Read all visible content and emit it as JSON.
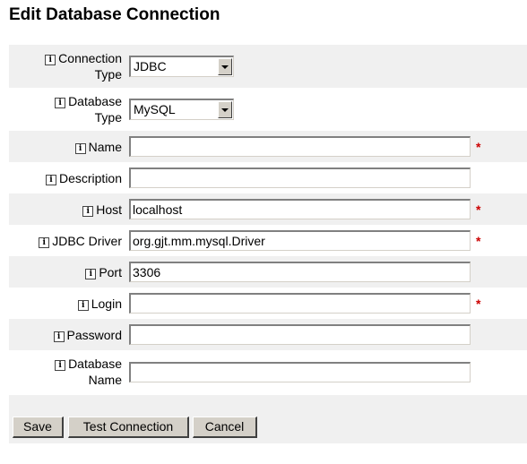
{
  "page": {
    "title": "Edit Database Connection"
  },
  "form": {
    "info_icon_glyph": "i",
    "required_mark": "*",
    "connection_type": {
      "label_line1": "Connection",
      "label_line2": "Type",
      "value": "JDBC"
    },
    "database_type": {
      "label_line1": "Database",
      "label_line2": "Type",
      "value": "MySQL"
    },
    "name": {
      "label": "Name",
      "value": "",
      "required": true
    },
    "description": {
      "label": "Description",
      "value": ""
    },
    "host": {
      "label": "Host",
      "value": "localhost",
      "required": true
    },
    "jdbc_driver": {
      "label": "JDBC Driver",
      "value": "org.gjt.mm.mysql.Driver",
      "required": true
    },
    "port": {
      "label": "Port",
      "value": "3306"
    },
    "login": {
      "label": "Login",
      "value": "",
      "required": true
    },
    "password": {
      "label": "Password",
      "value": ""
    },
    "database_name": {
      "label_line1": "Database",
      "label_line2": "Name",
      "value": ""
    }
  },
  "buttons": {
    "save": "Save",
    "test_connection": "Test Connection",
    "cancel": "Cancel"
  },
  "colors": {
    "row_shade": "#f0f0f0",
    "required": "#cc0000",
    "button_face": "#d4d0c8"
  }
}
